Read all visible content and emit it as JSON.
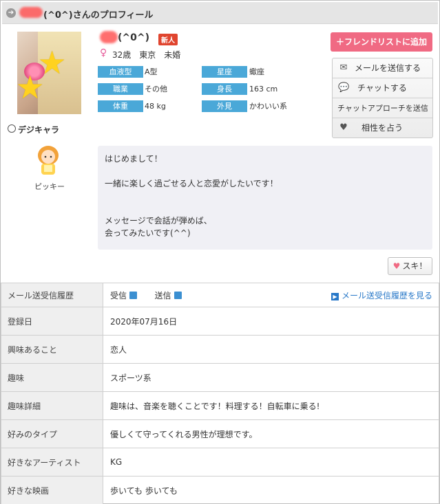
{
  "header": {
    "title": "(^0^)さんのプロフィール",
    "arrow_icon": "circle-arrow-right-icon"
  },
  "profile": {
    "name": "(^0^)",
    "new_badge": "新人",
    "gender_symbol": "♀",
    "summary": "32歳　東京　未婚",
    "attributes": [
      {
        "label": "血液型",
        "value": "A型"
      },
      {
        "label": "星座",
        "value": "蠍座"
      },
      {
        "label": "職業",
        "value": "その他"
      },
      {
        "label": "身長",
        "value": "163 cm"
      },
      {
        "label": "体重",
        "value": "48 kg"
      },
      {
        "label": "外見",
        "value": "かわいい系"
      }
    ]
  },
  "actions": {
    "friend_list": "フレンドリストに追加",
    "send_mail": "メールを送信する",
    "chat": "チャットする",
    "chat_approach": "チャットアプローチを送信",
    "compatibility": "相性を占う",
    "like": "スキ！"
  },
  "digichara": {
    "label": "デジキャラ",
    "name": "ピッキー"
  },
  "message": {
    "lines": [
      "はじめまして！",
      "",
      "一緒に楽しく過ごせる人と恋愛がしたいです！",
      "",
      "",
      "メッセージで会話が弾めば、",
      "会ってみたいです(^^)"
    ]
  },
  "details": {
    "mail_history": {
      "label": "メール送受信履歴",
      "received": "受信",
      "sent": "送信",
      "link": "メール送受信履歴を見る"
    },
    "rows": [
      {
        "label": "登録日",
        "value": "2020年07月16日"
      },
      {
        "label": "興味あること",
        "value": "恋人"
      },
      {
        "label": "趣味",
        "value": "スポーツ系"
      },
      {
        "label": "趣味詳細",
        "value": "趣味は、音楽を聴くことです！料理する！自転車に乗る!"
      },
      {
        "label": "好みのタイプ",
        "value": "優しくて守ってくれる男性が理想です。"
      },
      {
        "label": "好きなアーティスト",
        "value": "KG"
      },
      {
        "label": "好きな映画",
        "value": "歩いても 歩いても"
      }
    ]
  },
  "colors": {
    "accent_pink": "#f06a83",
    "label_blue": "#4aa8d8",
    "badge_red": "#e0452f"
  }
}
